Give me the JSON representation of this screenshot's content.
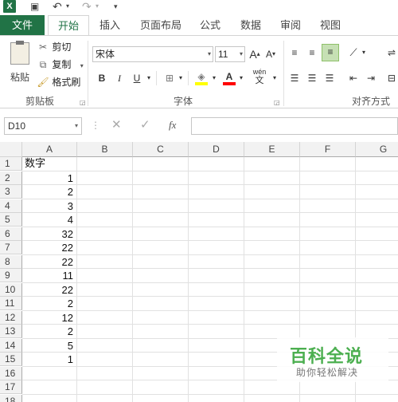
{
  "qat": {
    "app_icon": "excel-icon",
    "undo_icon": "undo-icon",
    "redo_icon": "redo-icon",
    "logo_letter": "X"
  },
  "tabs": [
    {
      "label": "文件"
    },
    {
      "label": "开始"
    },
    {
      "label": "插入"
    },
    {
      "label": "页面布局"
    },
    {
      "label": "公式"
    },
    {
      "label": "数据"
    },
    {
      "label": "审阅"
    },
    {
      "label": "视图"
    }
  ],
  "clipboard": {
    "paste_label": "粘贴",
    "cut_label": "剪切",
    "copy_label": "复制",
    "format_painter_label": "格式刷",
    "group_label": "剪贴板"
  },
  "font": {
    "font_name": "宋体",
    "font_size": "11",
    "grow_label": "A",
    "shrink_label": "A",
    "bold": "B",
    "italic": "I",
    "underline": "U",
    "font_color": "A",
    "phonetic_top": "wén",
    "phonetic_bottom": "文",
    "group_label": "字体"
  },
  "alignment": {
    "group_label": "对齐方式"
  },
  "formula_bar": {
    "name_box": "D10",
    "fx_label": "fx",
    "formula": ""
  },
  "columns": [
    "A",
    "B",
    "C",
    "D",
    "E",
    "F",
    "G"
  ],
  "rows": [
    "1",
    "2",
    "3",
    "4",
    "5",
    "6",
    "7",
    "8",
    "9",
    "10",
    "11",
    "12",
    "13",
    "14",
    "15",
    "16",
    "17",
    "18"
  ],
  "cells_a": [
    "数字",
    "1",
    "2",
    "3",
    "4",
    "32",
    "22",
    "22",
    "11",
    "22",
    "2",
    "12",
    "2",
    "5",
    "1",
    "",
    "",
    ""
  ],
  "watermark": {
    "title": "百科全说",
    "subtitle": "助你轻松解决"
  },
  "colors": {
    "accent": "#217346",
    "watermark": "#4caf50"
  }
}
